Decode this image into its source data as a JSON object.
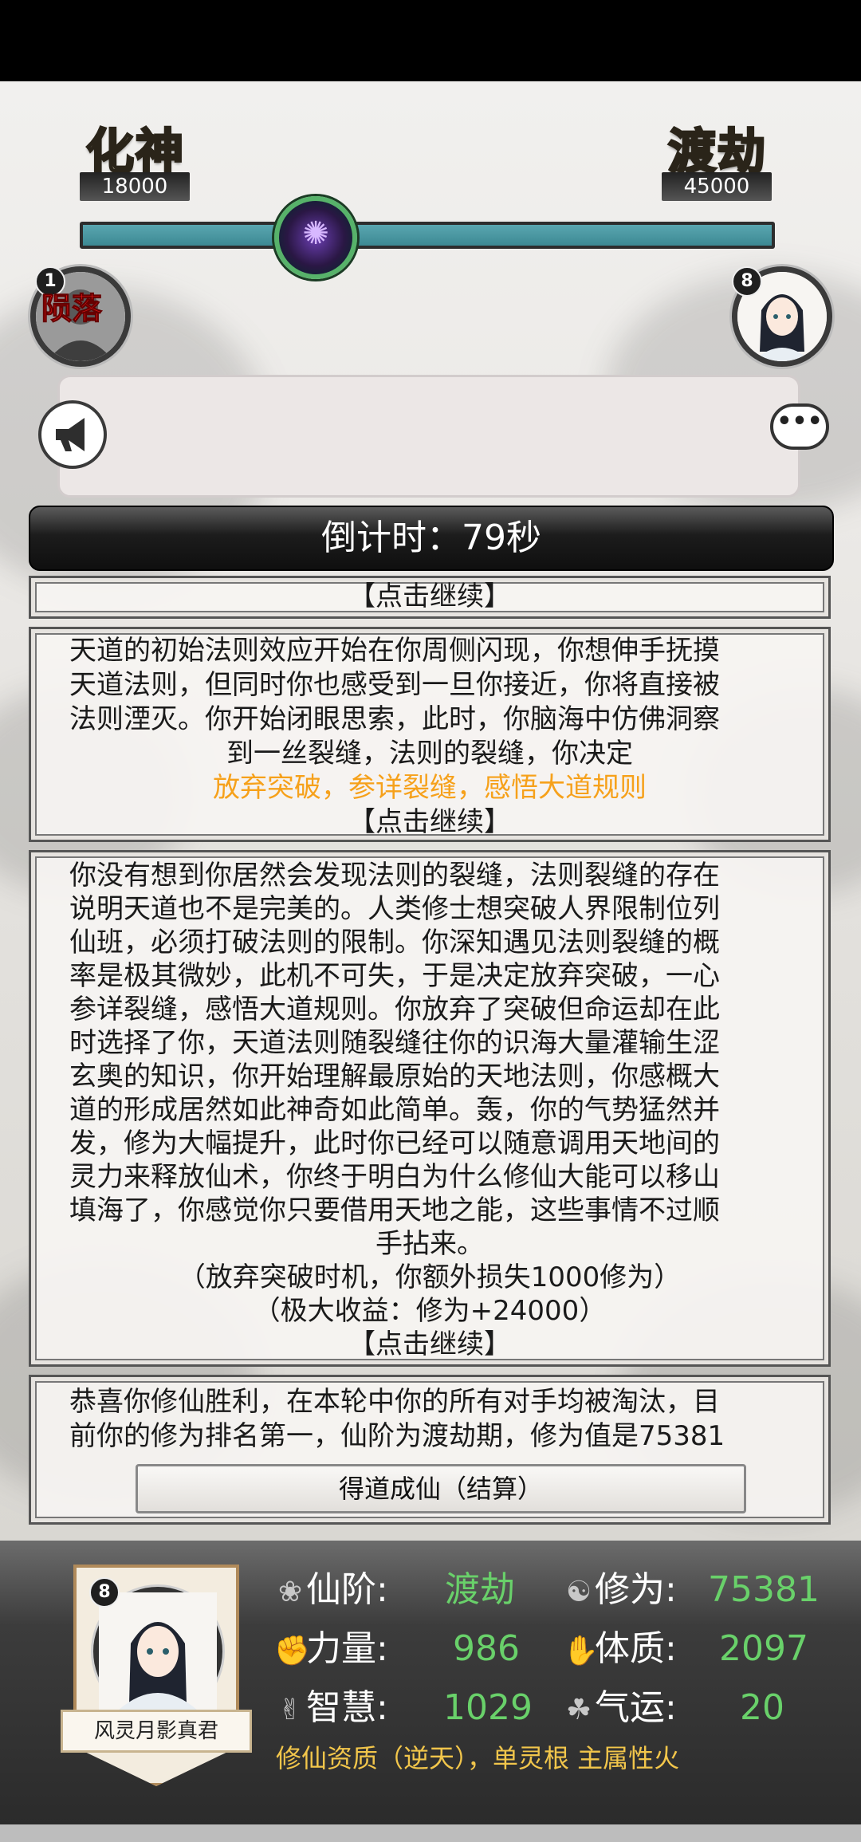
{
  "realms": {
    "left": {
      "name": "化神",
      "value": "18000"
    },
    "right": {
      "name": "渡劫",
      "value": "45000"
    }
  },
  "progress": {
    "fraction": 1.0
  },
  "players": {
    "left": {
      "rank": "1",
      "status": "陨落"
    },
    "right": {
      "rank": "8"
    }
  },
  "countdown": "倒计时：79秒",
  "story": {
    "panel1": {
      "continue": "【点击继续】"
    },
    "panel2": {
      "lines": [
        "天道的初始法则效应开始在你周侧闪现，你想伸手抚摸",
        "天道法则，但同时你也感受到一旦你接近，你将直接被",
        "法则湮灭。你开始闭眼思索，此时，你脑海中仿佛洞察"
      ],
      "center": "到一丝裂缝，法则的裂缝，你决定",
      "choice": "放弃突破，参详裂缝，感悟大道规则",
      "continue": "【点击继续】"
    },
    "panel3": {
      "lines": [
        "你没有想到你居然会发现法则的裂缝，法则裂缝的存在",
        "说明天道也不是完美的。人类修士想突破人界限制位列",
        "仙班，必须打破法则的限制。你深知遇见法则裂缝的概",
        "率是极其微妙，此机不可失，于是决定放弃突破，一心",
        "参详裂缝，感悟大道规则。你放弃了突破但命运却在此",
        "时选择了你，天道法则随裂缝往你的识海大量灌输生涩",
        "玄奥的知识，你开始理解最原始的天地法则，你感概大",
        "道的形成居然如此神奇如此简单。轰，你的气势猛然并",
        "发，修为大幅提升，此时你已经可以随意调用天地间的",
        "灵力来释放仙术，你终于明白为什么修仙大能可以移山",
        "填海了，你感觉你只要借用天地之能，这些事情不过顺"
      ],
      "center": "手拈来。",
      "loss": "（放弃突破时机，你额外损失1000修为）",
      "gain": "（极大收益：修为+24000）",
      "continue": "【点击继续】"
    },
    "panel4": {
      "lines": [
        "恭喜你修仙胜利，在本轮中你的所有对手均被淘汰，目",
        "前你的修为排名第一，仙阶为渡劫期，修为值是75381"
      ],
      "button": "得道成仙（结算）"
    }
  },
  "character": {
    "rank": "8",
    "name": "风灵月影真君",
    "stats": {
      "realm_label": "仙阶:",
      "realm_value": "渡劫",
      "cultivation_label": "修为:",
      "cultivation_value": "75381",
      "strength_label": "力量:",
      "strength_value": "986",
      "constitution_label": "体质:",
      "constitution_value": "2097",
      "wisdom_label": "智慧:",
      "wisdom_value": "1029",
      "luck_label": "气运:",
      "luck_value": "20"
    },
    "aptitude": "修仙资质（逆天），单灵根 主属性火"
  },
  "colors": {
    "accent_green": "#69d16a",
    "choice_orange": "#f6a11b",
    "aptitude_gold": "#f2c64b",
    "fallen_red": "#ff1a1a",
    "bar_teal": "#3c8993"
  }
}
